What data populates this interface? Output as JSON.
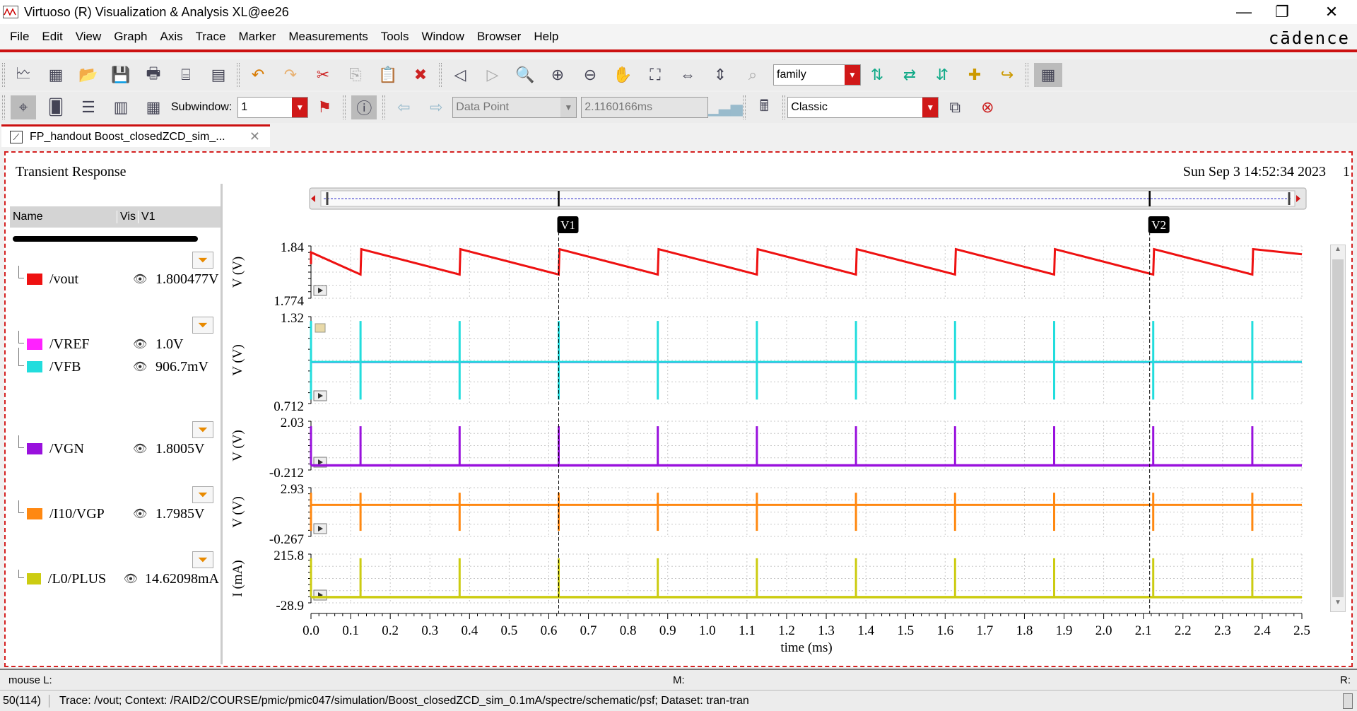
{
  "window": {
    "title": "Virtuoso (R) Visualization & Analysis XL@ee26"
  },
  "menu": [
    "File",
    "Edit",
    "View",
    "Graph",
    "Axis",
    "Trace",
    "Marker",
    "Measurements",
    "Tools",
    "Window",
    "Browser",
    "Help"
  ],
  "brand": "cādence",
  "toolbar2": {
    "family_value": "family",
    "subwindow_label": "Subwindow:",
    "subwindow_value": "1",
    "datapoint_value": "Data Point",
    "time_value": "2.1160166ms",
    "style_value": "Classic"
  },
  "tab": {
    "label": "FP_handout Boost_closedZCD_sim_..."
  },
  "graph": {
    "title": "Transient Response",
    "timestamp": "Sun Sep 3 14:52:34 2023",
    "page_number": "1",
    "legend_header": {
      "name": "Name",
      "vis": "Vis",
      "v1": "V1"
    },
    "legend": [
      {
        "name": "/vout",
        "value": "1.800477V",
        "color": "#ee1111"
      },
      {
        "name": "/VREF",
        "value": "1.0V",
        "color": "#ff22ff"
      },
      {
        "name": "/VFB",
        "value": "906.7mV",
        "color": "#22dddd"
      },
      {
        "name": "/VGN",
        "value": "1.8005V",
        "color": "#9911dd"
      },
      {
        "name": "/I10/VGP",
        "value": "1.7985V",
        "color": "#ff8811"
      },
      {
        "name": "/L0/PLUS",
        "value": "14.62098mA",
        "color": "#cccc11"
      }
    ],
    "markers": [
      {
        "label": "V1",
        "time_ms": 0.625
      },
      {
        "label": "V2",
        "time_ms": 2.116
      }
    ],
    "x_axis": {
      "label": "time (ms)",
      "ticks": [
        "0.0",
        "0.1",
        "0.2",
        "0.3",
        "0.4",
        "0.5",
        "0.6",
        "0.7",
        "0.8",
        "0.9",
        "1.0",
        "1.1",
        "1.2",
        "1.3",
        "1.4",
        "1.5",
        "1.6",
        "1.7",
        "1.8",
        "1.9",
        "2.0",
        "2.1",
        "2.2",
        "2.3",
        "2.4",
        "2.5"
      ]
    },
    "strips": [
      {
        "ylabel": "V (V)",
        "ymax": "1.84",
        "ymin": "1.774"
      },
      {
        "ylabel": "V (V)",
        "ymax": "1.32",
        "ymin": "0.712"
      },
      {
        "ylabel": "V (V)",
        "ymax": "2.03",
        "ymin": "-0.212"
      },
      {
        "ylabel": "V (V)",
        "ymax": "2.93",
        "ymin": "-0.267"
      },
      {
        "ylabel": "I (mA)",
        "ymax": "215.8",
        "ymin": "-28.9"
      }
    ]
  },
  "footer": {
    "mouse_l": "mouse L:",
    "m": "M:",
    "r": "R:"
  },
  "status": {
    "count": "50(114)",
    "text": "Trace: /vout; Context: /RAID2/COURSE/pmic/pmic047/simulation/Boost_closedZCD_sim_0.1mA/spectre/schematic/psf; Dataset: tran-tran"
  },
  "chart_data": {
    "type": "line",
    "xlabel": "time (ms)",
    "xlim": [
      0,
      2.5
    ],
    "switch_times_ms": [
      0.0,
      0.125,
      0.375,
      0.625,
      0.875,
      1.125,
      1.375,
      1.625,
      1.875,
      2.125,
      2.375
    ],
    "strips": [
      {
        "ylabel": "V (V)",
        "ylim": [
          1.774,
          1.84
        ],
        "series": [
          {
            "name": "/vout",
            "shape": "sawtooth",
            "peak": 1.836,
            "trough": 1.804
          }
        ]
      },
      {
        "ylabel": "V (V)",
        "ylim": [
          0.712,
          1.32
        ],
        "series": [
          {
            "name": "/VREF",
            "level": 1.0
          },
          {
            "name": "/VFB",
            "level": 1.003,
            "spike_max": 1.29,
            "spike_min": 0.74
          }
        ]
      },
      {
        "ylabel": "V (V)",
        "ylim": [
          -0.212,
          2.03
        ],
        "series": [
          {
            "name": "/VGN",
            "base": 0.0,
            "pulse": 1.8
          }
        ]
      },
      {
        "ylabel": "V (V)",
        "ylim": [
          -0.267,
          2.93
        ],
        "series": [
          {
            "name": "/I10/VGP",
            "base": 1.8,
            "pulse_max": 2.6,
            "pulse_min": 0.1
          }
        ]
      },
      {
        "ylabel": "I (mA)",
        "ylim": [
          -28.9,
          215.8
        ],
        "series": [
          {
            "name": "/L0/PLUS",
            "base": 0.0,
            "pulse": 195
          }
        ]
      }
    ]
  }
}
